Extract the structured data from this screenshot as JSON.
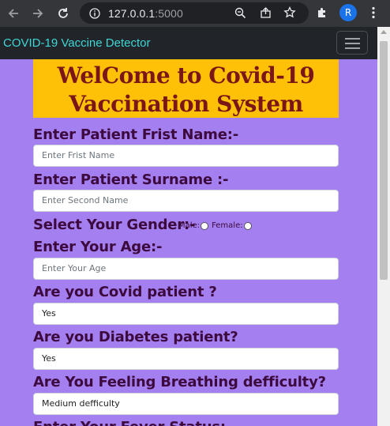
{
  "browser": {
    "url_host": "127.0.0.1",
    "url_port": ":5000",
    "profile_initial": "R"
  },
  "navbar": {
    "brand": "COVID-19 Vaccine Detector"
  },
  "banner": {
    "line1": "WelCome to Covid-19",
    "line2": "Vaccination System"
  },
  "form": {
    "first_name_label": "Enter Patient Frist Name:-",
    "first_name_placeholder": "Enter Frist Name",
    "surname_label": "Enter Patient Surname :-",
    "surname_placeholder": "Enter Second Name",
    "gender_label": "Select Your Gender:-",
    "gender_male": "Male:",
    "gender_female": "Female:",
    "age_label": "Enter Your Age:-",
    "age_placeholder": "Enter Your Age",
    "covid_label": "Are you Covid patient ?",
    "covid_value": "Yes",
    "diabetes_label": "Are you Diabetes patient?",
    "diabetes_value": "Yes",
    "breathing_label": "Are You Feeling Breathing defficulty?",
    "breathing_value": "Medium defficulty",
    "fever_label": "Enter Your Fever Status:-"
  },
  "colors": {
    "page_bg": "#a37ff0",
    "banner_bg": "#ffc107",
    "banner_text": "#7a1616",
    "label_text": "#3d0a3d",
    "brand_text": "#3fd6d6"
  }
}
